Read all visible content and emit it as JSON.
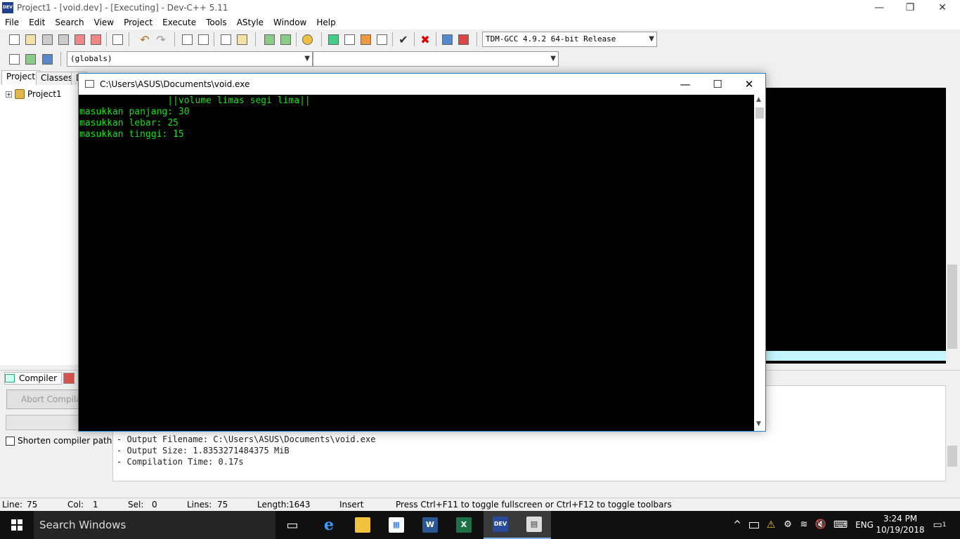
{
  "window": {
    "title": "Project1 - [void.dev] - [Executing] - Dev-C++ 5.11",
    "icon_label": "DEV",
    "controls": {
      "minimize": "—",
      "restore": "❐",
      "close": "✕"
    }
  },
  "menu": [
    "File",
    "Edit",
    "Search",
    "View",
    "Project",
    "Execute",
    "Tools",
    "AStyle",
    "Window",
    "Help"
  ],
  "toolbar": {
    "compiler_select": "TDM-GCC 4.9.2 64-bit Release",
    "scope_select": "(globals)",
    "function_select": ""
  },
  "left_panel": {
    "tabs": [
      "Project",
      "Classes",
      "D"
    ],
    "tree_expand": "+",
    "tree_root": "Project1"
  },
  "bottom_panel": {
    "tabs": [
      "Compiler"
    ],
    "abort_button": "Abort Compilation",
    "shorten_paths_label": "Shorten compiler paths",
    "log_lines": [
      "- Output Filename: C:\\Users\\ASUS\\Documents\\void.exe",
      "- Output Size: 1.8353271484375 MiB",
      "- Compilation Time: 0.17s"
    ]
  },
  "status_bar": {
    "line_label": "Line:",
    "line_value": "75",
    "col_label": "Col:",
    "col_value": "1",
    "sel_label": "Sel:",
    "sel_value": "0",
    "lines_label": "Lines:",
    "lines_value": "75",
    "length_label": "Length:",
    "length_value": "1643",
    "mode": "Insert",
    "hint": "Press Ctrl+F11 to toggle fullscreen or Ctrl+F12 to toggle toolbars"
  },
  "console": {
    "title": "C:\\Users\\ASUS\\Documents\\void.exe",
    "controls": {
      "minimize": "—",
      "maximize": "☐",
      "close": "✕"
    },
    "text_color": "#13e013",
    "lines": [
      "                ||volume limas segi lima||",
      "masukkan panjang: 30",
      "masukkan lebar: 25",
      "masukkan tinggi: 15"
    ]
  },
  "taskbar": {
    "search_placeholder": "Search Windows",
    "apps": [
      {
        "name": "task-view",
        "glyph": "▭"
      },
      {
        "name": "edge",
        "glyph": "e"
      },
      {
        "name": "file-explorer",
        "glyph": "▬"
      },
      {
        "name": "store",
        "glyph": "▦"
      },
      {
        "name": "word",
        "glyph": "W"
      },
      {
        "name": "excel",
        "glyph": "X"
      },
      {
        "name": "devcpp",
        "glyph": "DEV"
      },
      {
        "name": "console",
        "glyph": "▤"
      }
    ],
    "tray": {
      "chevron": "^",
      "language": "ENG",
      "time": "3:24 PM",
      "date": "10/19/2018",
      "notification_count": "1"
    }
  }
}
